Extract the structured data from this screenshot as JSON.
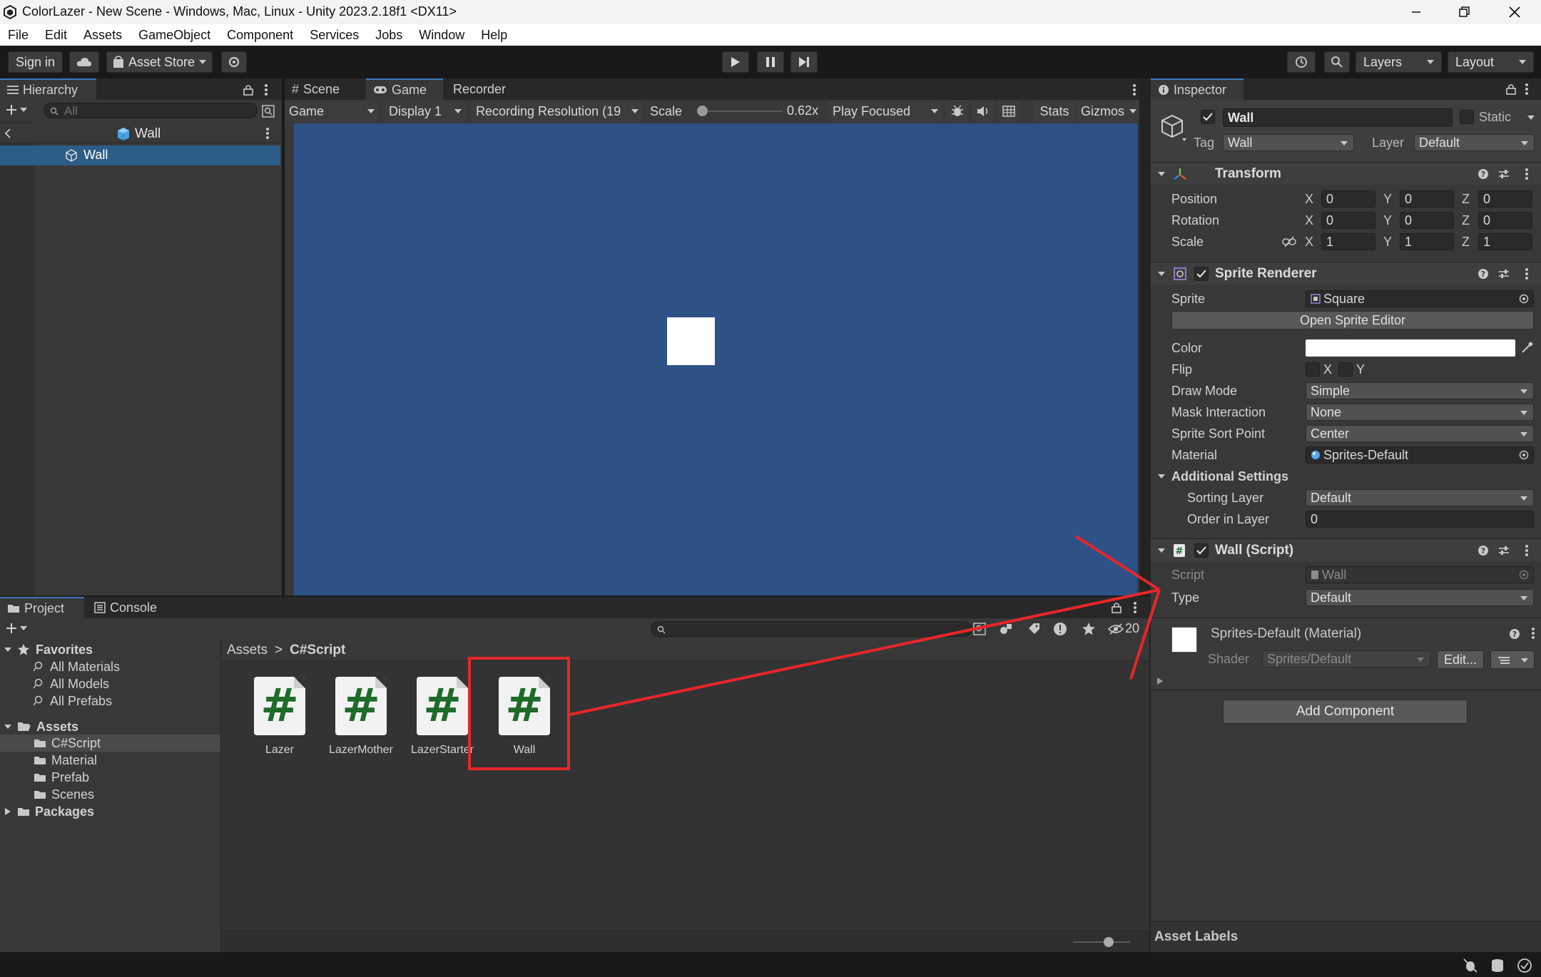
{
  "window": {
    "title": "ColorLazer - New Scene - Windows, Mac, Linux - Unity 2023.2.18f1 <DX11>"
  },
  "menu": [
    "File",
    "Edit",
    "Assets",
    "GameObject",
    "Component",
    "Services",
    "Jobs",
    "Window",
    "Help"
  ],
  "toolbar": {
    "sign_in": "Sign in",
    "asset_store": "Asset Store",
    "layers": "Layers",
    "layout": "Layout"
  },
  "hierarchy": {
    "tab": "Hierarchy",
    "search_placeholder": "All",
    "breadcrumb": "Wall",
    "items": [
      "Wall"
    ]
  },
  "game_view": {
    "tabs": [
      "Scene",
      "Game",
      "Recorder"
    ],
    "view_mode": "Game",
    "display": "Display 1",
    "resolution": "Recording Resolution (19",
    "scale_label": "Scale",
    "scale_value": "0.62x",
    "scale_fraction": 0.0,
    "play_mode": "Play Focused",
    "stats": "Stats",
    "gizmos": "Gizmos",
    "background_color": "#2e5186"
  },
  "project": {
    "tabs": [
      "Project",
      "Console"
    ],
    "hidden_count": "20",
    "breadcrumb_root": "Assets",
    "breadcrumb_sep": ">",
    "breadcrumb_current": "C#Script",
    "favorites_label": "Favorites",
    "favorites": [
      "All Materials",
      "All Models",
      "All Prefabs"
    ],
    "assets_label": "Assets",
    "asset_folders": [
      "C#Script",
      "Material",
      "Prefab",
      "Scenes"
    ],
    "packages_label": "Packages",
    "files": [
      "Lazer",
      "LazerMother",
      "LazerStarter",
      "Wall"
    ],
    "file_glyph": "#"
  },
  "inspector": {
    "tab": "Inspector",
    "object_name": "Wall",
    "static_label": "Static",
    "tag_label": "Tag",
    "tag_value": "Wall",
    "layer_label": "Layer",
    "layer_value": "Default",
    "transform": {
      "title": "Transform",
      "position_label": "Position",
      "rotation_label": "Rotation",
      "scale_label": "Scale",
      "position": [
        "0",
        "0",
        "0"
      ],
      "rotation": [
        "0",
        "0",
        "0"
      ],
      "scale": [
        "1",
        "1",
        "1"
      ],
      "axes": [
        "X",
        "Y",
        "Z"
      ]
    },
    "sprite_renderer": {
      "title": "Sprite Renderer",
      "sprite_label": "Sprite",
      "sprite_value": "Square",
      "open_editor": "Open Sprite Editor",
      "color_label": "Color",
      "color_value": "#ffffff",
      "flip_label": "Flip",
      "flip_x": "X",
      "flip_y": "Y",
      "draw_mode_label": "Draw Mode",
      "draw_mode": "Simple",
      "mask_label": "Mask Interaction",
      "mask": "None",
      "sort_point_label": "Sprite Sort Point",
      "sort_point": "Center",
      "material_label": "Material",
      "material": "Sprites-Default",
      "additional": "Additional Settings",
      "sorting_layer_label": "Sorting Layer",
      "sorting_layer": "Default",
      "order_label": "Order in Layer",
      "order": "0"
    },
    "wall_script": {
      "title": "Wall (Script)",
      "script_label": "Script",
      "script_value": "Wall",
      "type_label": "Type",
      "type_value": "Default"
    },
    "material": {
      "title": "Sprites-Default (Material)",
      "shader_label": "Shader",
      "shader_value": "Sprites/Default",
      "edit": "Edit..."
    },
    "add_component": "Add Component",
    "asset_labels": "Asset Labels"
  },
  "annotation": {
    "highlight_color": "#e8262a"
  }
}
